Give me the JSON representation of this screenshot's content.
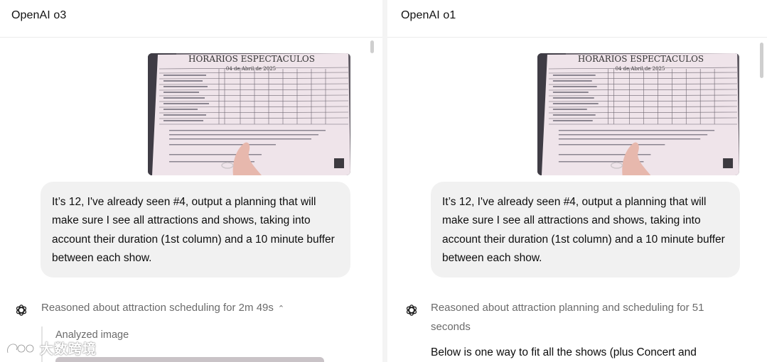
{
  "left_pane": {
    "title": "OpenAI o3",
    "prompt": "It’s 12, I've already seen #4, output a planning that will make sure I see all attractions and shows, taking into account their duration (1st column) and a 10 minute buffer between each show.",
    "reasoning_label": "Reasoned about attraction scheduling for 2m 49s",
    "reasoning_expanded": true,
    "analyzed_label": "Analyzed image"
  },
  "right_pane": {
    "title": "OpenAI o1",
    "prompt": "It’s 12, I've already seen #4, output a planning that will make sure I see all attractions and shows, taking into account their duration (1st column) and a 10 minute buffer between each show.",
    "reasoning_label": "Reasoned about attraction planning and scheduling for 51 seconds",
    "answer_start": "Below is one way to fit all the shows (plus Concert and"
  },
  "photo": {
    "heading": "HORARIOS ESPECTACULOS",
    "date": "04 de Abril de 2025"
  },
  "watermark": {
    "text": "大数跨境"
  },
  "colors": {
    "bubble_bg": "#f1f1f1",
    "muted_text": "#6b6b6b",
    "paper": "#efe6ec"
  },
  "icons": {
    "assistant": "openai-logo-icon",
    "expand": "chevron-up-icon"
  }
}
